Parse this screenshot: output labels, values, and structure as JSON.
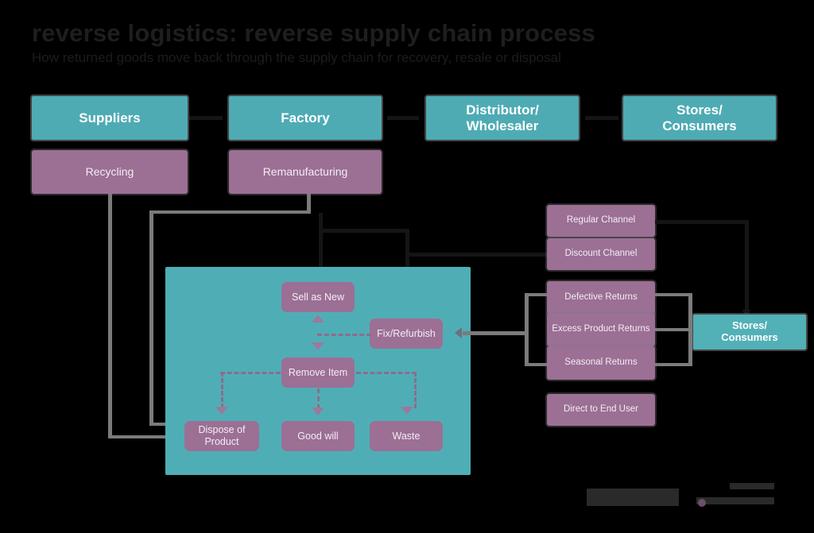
{
  "header": {
    "title": "reverse logistics: reverse supply chain process",
    "subtitle": "How returned goods move back through the supply chain for recovery, resale or disposal"
  },
  "forward_chain": {
    "nodes": [
      {
        "id": "suppliers",
        "label": "Suppliers"
      },
      {
        "id": "factory",
        "label": "Factory"
      },
      {
        "id": "distributor",
        "label": "Distributor/\nWholesaler"
      },
      {
        "id": "stores",
        "label": "Stores/\nConsumers"
      }
    ],
    "connector_count": 3
  },
  "recovery_nodes": [
    {
      "id": "recycling",
      "label": "Recycling"
    },
    {
      "id": "remanufacturing",
      "label": "Remanufacturing"
    }
  ],
  "disposition_panel": {
    "nodes": [
      {
        "id": "sell-as-new",
        "label": "Sell as New"
      },
      {
        "id": "fix-refurbish",
        "label": "Fix/Refurbish"
      },
      {
        "id": "remove-item",
        "label": "Remove Item"
      },
      {
        "id": "dispose-of-product",
        "label": "Dispose of\nProduct"
      },
      {
        "id": "good-will",
        "label": "Good will"
      },
      {
        "id": "waste",
        "label": "Waste"
      }
    ]
  },
  "channels": [
    {
      "id": "regular-channel",
      "label": "Regular Channel"
    },
    {
      "id": "discount-channel",
      "label": "Discount Channel"
    }
  ],
  "returns": [
    {
      "id": "defective-returns",
      "label": "Defective Returns"
    },
    {
      "id": "excess-product-returns",
      "label": "Excess Product Returns"
    },
    {
      "id": "seasonal-returns",
      "label": "Seasonal Returns"
    }
  ],
  "direct_channel": {
    "id": "direct-to-end-user",
    "label": "Direct to End User"
  },
  "end_node": {
    "id": "stores-consumers-right",
    "label": "Stores/\nConsumers"
  },
  "colors": {
    "background": "#000000",
    "panel_teal": "#4faeb5",
    "box_teal": "#4eabb4",
    "box_purple": "#9c6f95",
    "connector_gray": "#7b7b7b",
    "text_light": "#ffffff",
    "header_text": "#1e1e1e"
  },
  "footer": {
    "brand_bar": "",
    "caption": ""
  }
}
